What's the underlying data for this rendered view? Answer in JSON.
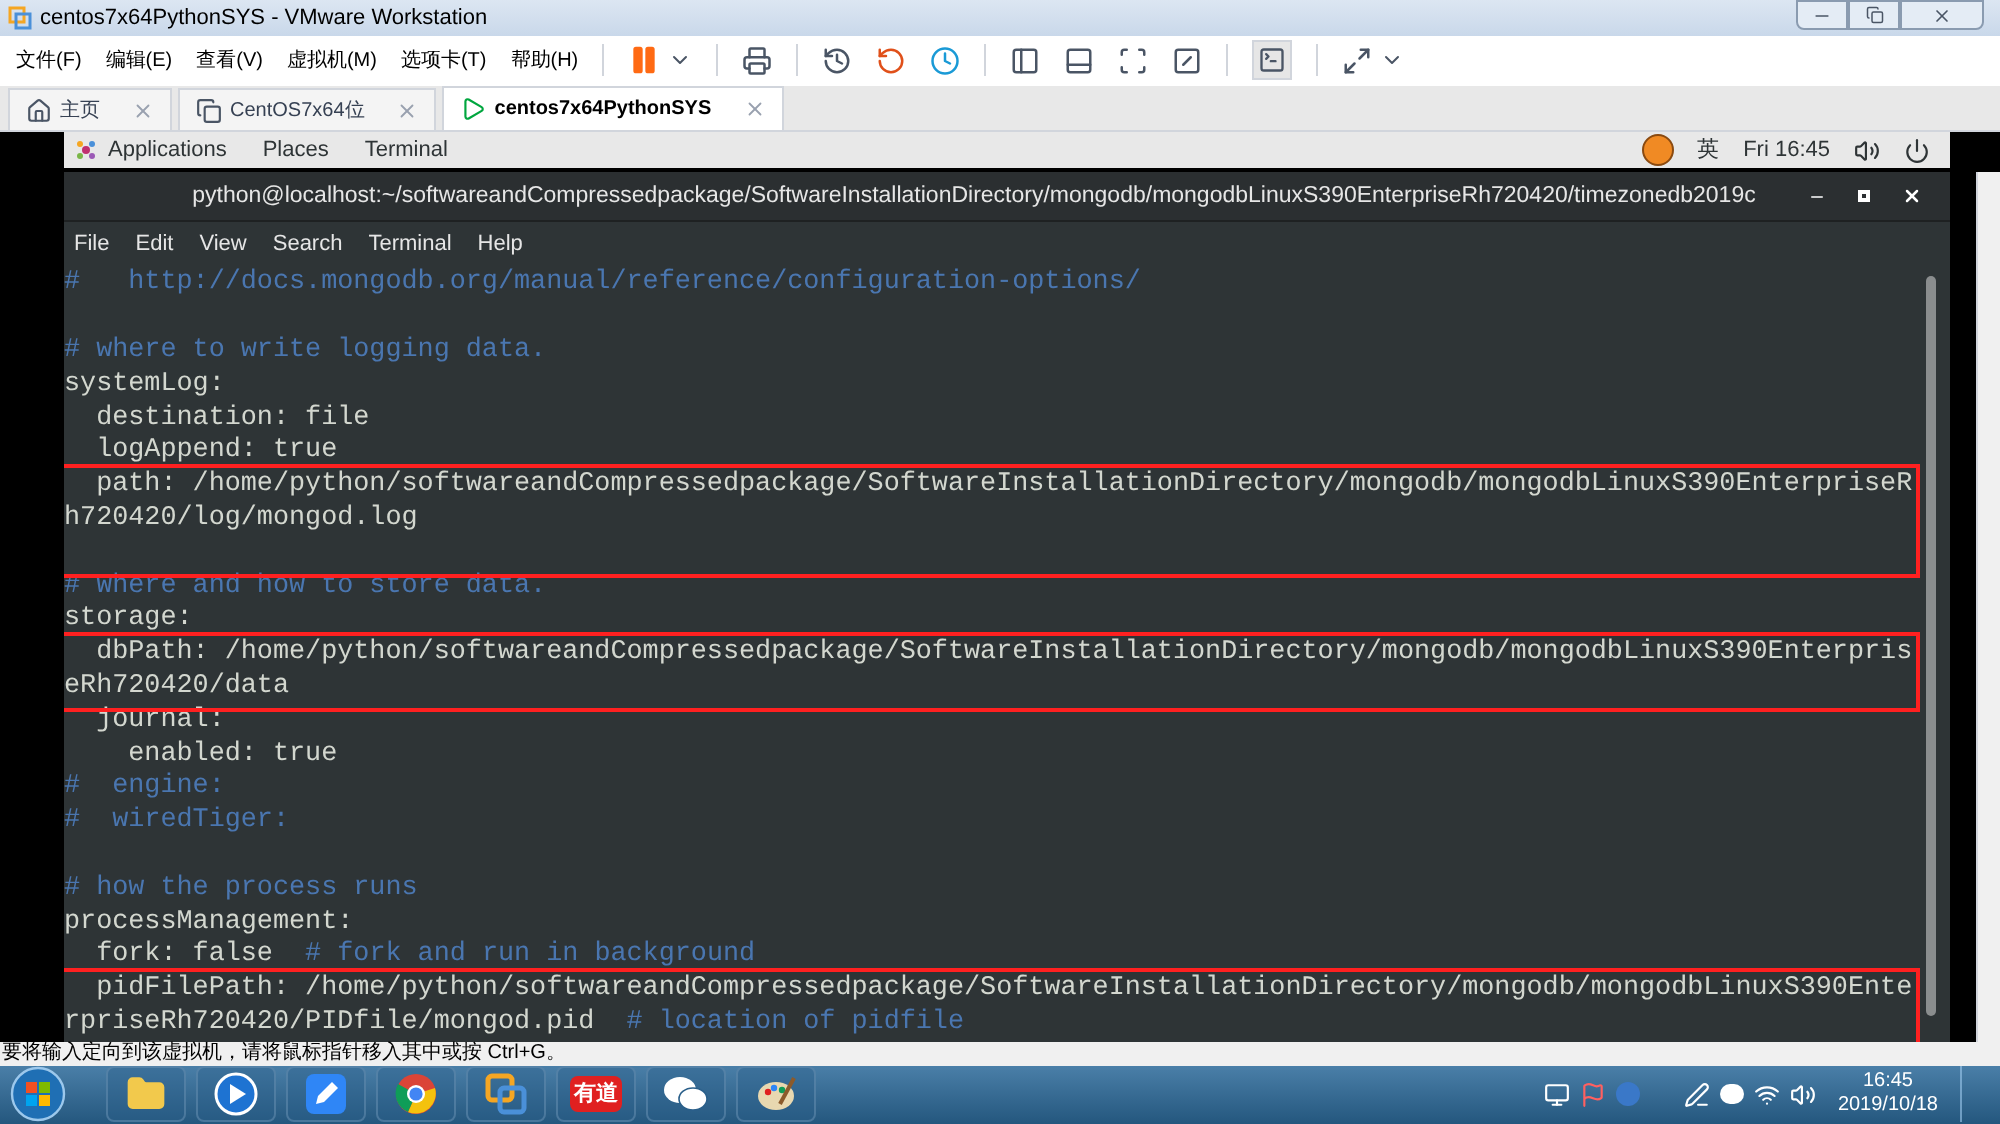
{
  "window": {
    "title": "centos7x64PythonSYS - VMware Workstation"
  },
  "menu": [
    "文件(F)",
    "编辑(E)",
    "查看(V)",
    "虚拟机(M)",
    "选项卡(T)",
    "帮助(H)"
  ],
  "tabs": [
    {
      "kind": "home",
      "label": "主页",
      "selected": false
    },
    {
      "kind": "vm",
      "label": "CentOS7x64位",
      "selected": false
    },
    {
      "kind": "running",
      "label": "centos7x64PythonSYS",
      "selected": true
    }
  ],
  "gnome_bar": {
    "menus": [
      "Applications",
      "Places",
      "Terminal"
    ],
    "input_method": "英",
    "clock": "Fri 16:45"
  },
  "terminal": {
    "title": "python@localhost:~/softwareandCompressedpackage/SoftwareInstallationDirectory/mongodb/mongodbLinuxS390EnterpriseRh720420/timezonedb2019c",
    "menu": [
      "File",
      "Edit",
      "View",
      "Search",
      "Terminal",
      "Help"
    ],
    "blocks": [
      {
        "highlighted": false,
        "lines": [
          {
            "kind": "comment",
            "comment": "#   http://docs.mongodb.org/manual/reference/configuration-options/"
          },
          {
            "kind": "blank"
          },
          {
            "kind": "comment",
            "comment": "# where to write logging data."
          },
          {
            "kind": "code",
            "code": "systemLog:"
          },
          {
            "kind": "code",
            "code": "  destination: file"
          },
          {
            "kind": "code",
            "code": "  logAppend: true"
          }
        ]
      },
      {
        "highlighted": true,
        "lines": [
          {
            "kind": "code",
            "code": "  path: /home/python/softwareandCompressedpackage/SoftwareInstallationDirectory/mongodb/mongodbLinuxS390EnterpriseR"
          },
          {
            "kind": "code",
            "code": "h720420/log/mongod.log"
          },
          {
            "kind": "blank"
          }
        ]
      },
      {
        "highlighted": false,
        "lines": [
          {
            "kind": "comment",
            "comment": "# Where and how to store data."
          },
          {
            "kind": "code",
            "code": "storage:"
          }
        ]
      },
      {
        "highlighted": true,
        "lines": [
          {
            "kind": "code",
            "code": "  dbPath: /home/python/softwareandCompressedpackage/SoftwareInstallationDirectory/mongodb/mongodbLinuxS390Enterpris"
          },
          {
            "kind": "code",
            "code": "eRh720420/data"
          }
        ]
      },
      {
        "highlighted": false,
        "lines": [
          {
            "kind": "code",
            "code": "  journal:"
          },
          {
            "kind": "code",
            "code": "    enabled: true"
          },
          {
            "kind": "comment",
            "comment": "#  engine:"
          },
          {
            "kind": "comment",
            "comment": "#  wiredTiger:"
          },
          {
            "kind": "blank"
          },
          {
            "kind": "comment",
            "comment": "# how the process runs"
          },
          {
            "kind": "code",
            "code": "processManagement:"
          },
          {
            "kind": "mixed",
            "code": "  fork: false  ",
            "comment": "# fork and run in background"
          }
        ]
      },
      {
        "highlighted": true,
        "lines": [
          {
            "kind": "code",
            "code": "  pidFilePath: /home/python/softwareandCompressedpackage/SoftwareInstallationDirectory/mongodb/mongodbLinuxS390Ente"
          },
          {
            "kind": "mixed",
            "code": "rpriseRh720420/PIDfile/mongod.pid  ",
            "comment": "# location of pidfile"
          }
        ]
      }
    ]
  },
  "status_message": "要将输入定向到该虚拟机，请将鼠标指针移入其中或按 Ctrl+G。",
  "taskbar": {
    "apps": [
      {
        "kind": "explorer"
      },
      {
        "kind": "media"
      },
      {
        "kind": "notes"
      },
      {
        "kind": "chrome"
      },
      {
        "kind": "vmware"
      },
      {
        "kind": "youdao",
        "label": "有道"
      },
      {
        "kind": "wechat"
      },
      {
        "kind": "paint"
      }
    ],
    "time": "16:45",
    "date": "2019/10/18"
  }
}
